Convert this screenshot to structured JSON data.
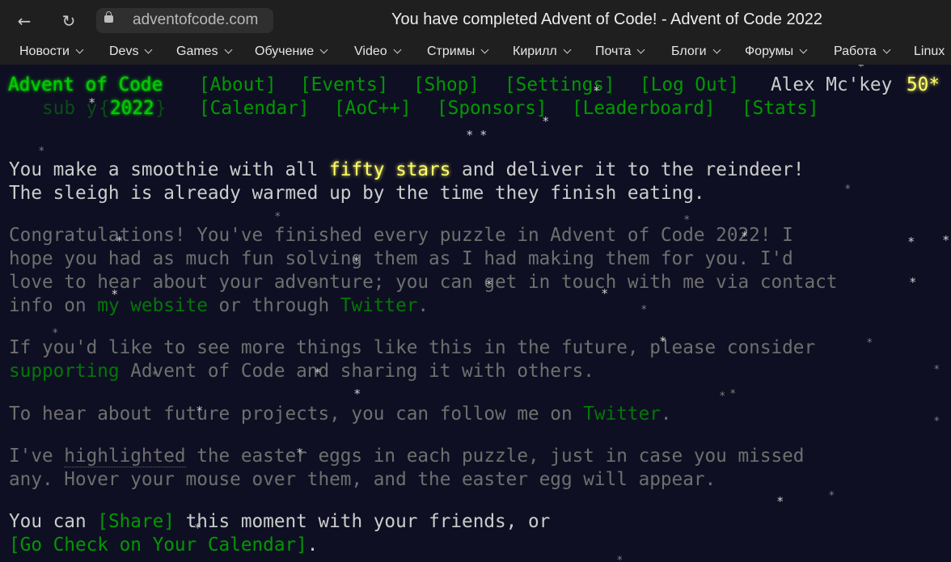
{
  "browser": {
    "address": "adventofcode.com",
    "window_title": "You have completed Advent of Code! - Advent of Code 2022",
    "back_glyph": "←",
    "reload_glyph": "↻",
    "bookmarks": [
      "Новости",
      "Devs",
      "Games",
      "Обучение",
      "Video",
      "Стримы",
      "Кирилл",
      "Почта",
      "Блоги",
      "Форумы",
      "Работа",
      "Linux"
    ]
  },
  "header": {
    "logo": "Advent of Code",
    "nav_row1": [
      "[About]",
      "[Events]",
      "[Shop]",
      "[Settings]",
      "[Log Out]"
    ],
    "user": "Alex Mc'key",
    "stars": "50*",
    "sub_prefix": "sub y",
    "sub_suffix": "{",
    "year": "2022",
    "sub_close": "}",
    "nav_row2": [
      "[Calendar]",
      "[AoC++]",
      "[Sponsors]",
      "[Leaderboard]",
      "[Stats]"
    ]
  },
  "main": {
    "p1a": "You make a smoothie with all ",
    "p1_fifty": "fifty stars",
    "p1b": " and deliver it to the reindeer!",
    "p1c": "The sleigh is already warmed up by the time they finish eating.",
    "p2a": "Congratulations! You've finished every puzzle in Advent of Code 2022! I",
    "p2b": "hope you had as much fun solving them as I had making them for you. I'd",
    "p2c": "love to hear about your adventure; you can get in touch with me via contact",
    "p2d_a": "info on ",
    "p2d_link1": "my website",
    "p2d_b": " or through ",
    "p2d_link2": "Twitter",
    "p2d_c": ".",
    "p3a": "If you'd like to see more things like this in the future, please consider",
    "p3_link": "supporting",
    "p3b": " Advent of Code and sharing it with others.",
    "p4a": "To hear about future projects, you can follow me on ",
    "p4_link": "Twitter",
    "p4b": ".",
    "p5a_pre": "I've ",
    "p5_hl": "highlighted",
    "p5a_post": " the easter eggs in each puzzle, just in case you missed",
    "p5b": "any. Hover your mouse over them, and the easter egg will appear.",
    "p6a": "You can ",
    "p6_share": "[Share]",
    "p6b": " this moment with your friends, or",
    "p6_calendar": "[Go Check on Your Calendar]",
    "p6c": "."
  },
  "star_glyph": "*"
}
